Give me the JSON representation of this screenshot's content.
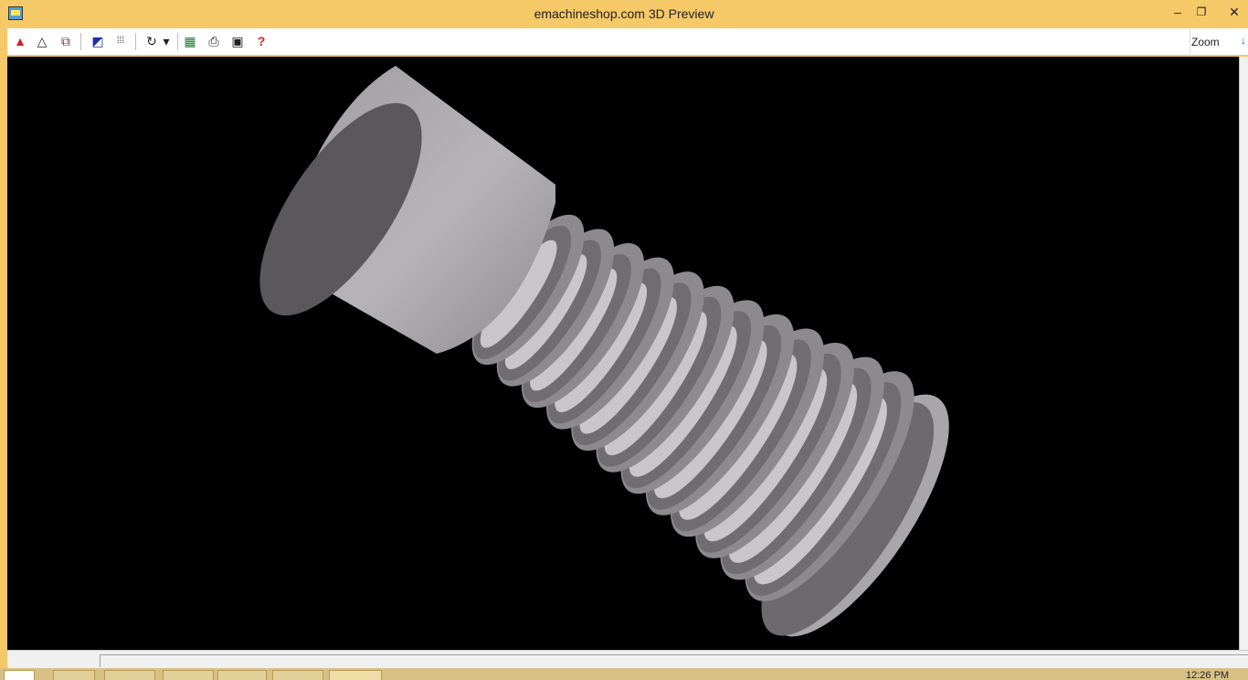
{
  "window": {
    "title": "emachineshop.com 3D Preview",
    "minimize": "–",
    "maximize": "❐",
    "close": "✕"
  },
  "toolbar": {
    "zoom_label": "Zoom",
    "zoom_arrow": "↓",
    "icons": [
      {
        "name": "solid-view-icon",
        "glyph": "▲",
        "color": "#d81e1e"
      },
      {
        "name": "wireframe-view-icon",
        "glyph": "△",
        "color": "#222222"
      },
      {
        "name": "parts-view-icon",
        "glyph": "⧉",
        "color": "#8a2b2b"
      },
      {
        "name": "color-icon",
        "glyph": "◩",
        "color": "#1a2ea8"
      },
      {
        "name": "grid-icon",
        "glyph": "⁞⁞⁞",
        "color": "#222222"
      },
      {
        "name": "rotate-icon",
        "glyph": "↻",
        "color": "#222222"
      },
      {
        "name": "rotate-dropdown-icon",
        "glyph": "▾",
        "color": "#222222"
      },
      {
        "name": "palette-icon",
        "glyph": "▦",
        "color": "#1e7a2e"
      },
      {
        "name": "print-icon",
        "glyph": "⎙",
        "color": "#222222"
      },
      {
        "name": "save-icon",
        "glyph": "▣",
        "color": "#222222"
      },
      {
        "name": "help-icon",
        "glyph": "?",
        "color": "#d81e1e"
      }
    ]
  },
  "status": {
    "clock": "12:26 PM"
  },
  "colors": {
    "frame": "#f5c868",
    "viewport_background": "#000000",
    "part_light": "#a9a6aa",
    "part_dark": "#5a585b"
  }
}
